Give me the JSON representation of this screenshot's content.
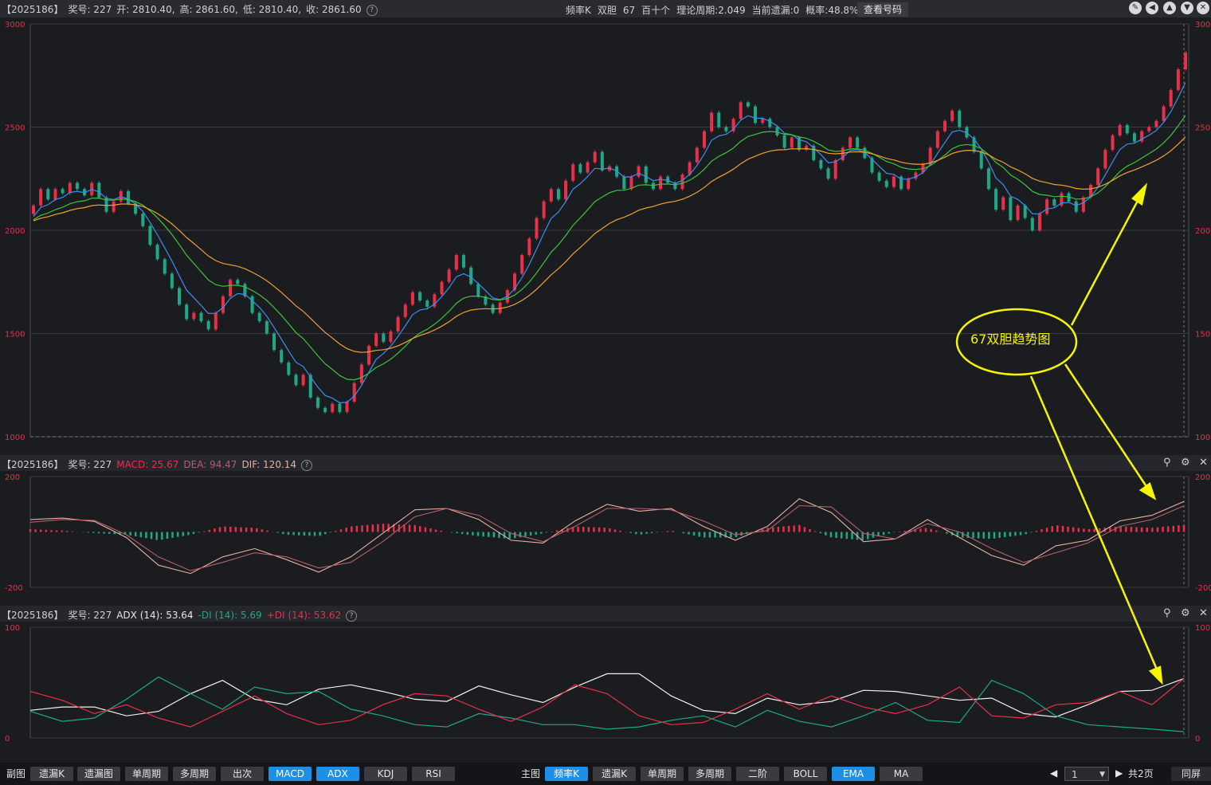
{
  "main_header": {
    "period": "【2025186】",
    "award": "奖号: 227",
    "open": "开: 2810.40,",
    "high": "高: 2861.60,",
    "low": "低: 2810.40,",
    "close": "收: 2861.60",
    "info": [
      "频率K",
      "双胆",
      "67",
      "百十个",
      "理论周期:2.049",
      "当前遗漏:0",
      "概率:48.8%"
    ],
    "view_button": "查看号码"
  },
  "macd_header": {
    "period": "【2025186】",
    "award": "奖号: 227",
    "macd": "MACD: 25.67",
    "dea": "DEA: 94.47",
    "dif": "DIF: 120.14"
  },
  "adx_header": {
    "period": "【2025186】",
    "award": "奖号: 227",
    "adx": "ADX (14): 53.64",
    "mdi": "-DI  (14): 5.69",
    "pdi": "+DI  (14): 53.62"
  },
  "annotation": "67双胆趋势图",
  "toolbar": {
    "sub_label": "副图",
    "sub_buttons": [
      "遗漏K",
      "遗漏图",
      "单周期",
      "多周期",
      "出次",
      "MACD",
      "ADX",
      "KDJ",
      "RSI"
    ],
    "sub_active": [
      "MACD",
      "ADX"
    ],
    "main_label": "主图",
    "main_buttons": [
      "频率K",
      "遗漏K",
      "单周期",
      "多周期",
      "二阶",
      "BOLL",
      "EMA",
      "MA"
    ],
    "main_active": [
      "频率K",
      "EMA"
    ],
    "page_value": "1",
    "page_total": "共2页",
    "same_screen": "同屏"
  },
  "colors": {
    "background": "#1b1c20",
    "up": "#e8304a",
    "down": "#1ea887",
    "ema_fast": "#3b8ff0",
    "ema_mid": "#3cc43c",
    "ema_slow": "#f0a030",
    "annotation": "#f5f500"
  },
  "chart_data": [
    {
      "type": "candlestick",
      "ylim": [
        1000,
        3000
      ],
      "yticks": [
        "3000",
        "2500",
        "2000",
        "1500",
        "1000"
      ],
      "close": [
        2120,
        2200,
        2150,
        2200,
        2180,
        2230,
        2200,
        2170,
        2230,
        2160,
        2090,
        2140,
        2190,
        2130,
        2080,
        2020,
        1930,
        1860,
        1790,
        1720,
        1640,
        1570,
        1600,
        1560,
        1520,
        1600,
        1680,
        1760,
        1740,
        1680,
        1600,
        1560,
        1500,
        1420,
        1360,
        1300,
        1250,
        1300,
        1190,
        1140,
        1120,
        1160,
        1120,
        1170,
        1260,
        1350,
        1440,
        1500,
        1460,
        1510,
        1580,
        1640,
        1700,
        1660,
        1630,
        1690,
        1750,
        1810,
        1880,
        1820,
        1740,
        1680,
        1640,
        1600,
        1650,
        1710,
        1790,
        1880,
        1960,
        2060,
        2140,
        2200,
        2150,
        2240,
        2320,
        2280,
        2330,
        2380,
        2290,
        2310,
        2260,
        2200,
        2260,
        2310,
        2230,
        2200,
        2260,
        2230,
        2200,
        2270,
        2330,
        2400,
        2480,
        2570,
        2500,
        2480,
        2540,
        2620,
        2600,
        2520,
        2540,
        2500,
        2460,
        2400,
        2450,
        2390,
        2410,
        2340,
        2300,
        2250,
        2340,
        2400,
        2450,
        2400,
        2350,
        2280,
        2240,
        2210,
        2260,
        2200,
        2250,
        2280,
        2320,
        2400,
        2480,
        2530,
        2580,
        2500,
        2450,
        2380,
        2300,
        2200,
        2100,
        2160,
        2050,
        2120,
        2060,
        2000,
        2080,
        2150,
        2120,
        2180,
        2140,
        2090,
        2160,
        2220,
        2300,
        2390,
        2460,
        2510,
        2470,
        2430,
        2480,
        2500,
        2530,
        2600,
        2680,
        2780,
        2861.6
      ]
    },
    {
      "type": "line",
      "ylim": [
        -200,
        200
      ],
      "yticks": [
        "200",
        "-200"
      ],
      "series": [
        {
          "name": "DIF",
          "values": [
            45,
            50,
            38,
            -20,
            -120,
            -150,
            -90,
            -60,
            -100,
            -145,
            -90,
            -5,
            80,
            85,
            45,
            -30,
            -40,
            40,
            100,
            75,
            85,
            20,
            -30,
            20,
            120,
            70,
            -35,
            -25,
            45,
            -20,
            -85,
            -120,
            -50,
            -30,
            40,
            60,
            110
          ]
        },
        {
          "name": "DEA",
          "values": [
            35,
            45,
            42,
            -10,
            -90,
            -140,
            -110,
            -75,
            -90,
            -130,
            -110,
            -35,
            55,
            85,
            60,
            -5,
            -35,
            20,
            85,
            85,
            80,
            40,
            -10,
            5,
            95,
            90,
            -5,
            -25,
            30,
            0,
            -60,
            -110,
            -75,
            -40,
            20,
            45,
            94.47
          ]
        },
        {
          "name": "MACD",
          "values": [
            10,
            5,
            -4,
            -10,
            -30,
            -10,
            20,
            15,
            -10,
            -15,
            20,
            30,
            25,
            0,
            -15,
            -25,
            -5,
            20,
            15,
            -10,
            5,
            -20,
            -20,
            15,
            25,
            -20,
            -30,
            0,
            15,
            -20,
            -25,
            -10,
            25,
            10,
            20,
            15,
            25.67
          ]
        }
      ]
    },
    {
      "type": "line",
      "ylim": [
        0,
        100
      ],
      "yticks": [
        "100",
        "0"
      ],
      "series": [
        {
          "name": "ADX",
          "values": [
            25,
            28,
            28,
            20,
            24,
            40,
            52,
            35,
            30,
            44,
            48,
            42,
            35,
            33,
            47,
            39,
            32,
            46,
            58,
            58,
            38,
            25,
            22,
            36,
            30,
            33,
            43,
            42,
            38,
            34,
            36,
            22,
            19,
            30,
            42,
            43,
            53.64
          ]
        },
        {
          "name": "-DI",
          "values": [
            24,
            15,
            18,
            35,
            55,
            40,
            26,
            46,
            40,
            42,
            26,
            20,
            12,
            10,
            22,
            18,
            12,
            12,
            8,
            10,
            16,
            20,
            10,
            25,
            15,
            10,
            20,
            32,
            16,
            14,
            52,
            40,
            20,
            12,
            10,
            8,
            5.69
          ]
        },
        {
          "name": "+DI",
          "values": [
            42,
            34,
            22,
            30,
            18,
            10,
            24,
            38,
            22,
            12,
            16,
            30,
            40,
            38,
            26,
            15,
            28,
            48,
            40,
            20,
            12,
            14,
            26,
            40,
            26,
            38,
            28,
            22,
            30,
            46,
            20,
            18,
            30,
            32,
            42,
            30,
            53.62
          ]
        }
      ]
    }
  ]
}
